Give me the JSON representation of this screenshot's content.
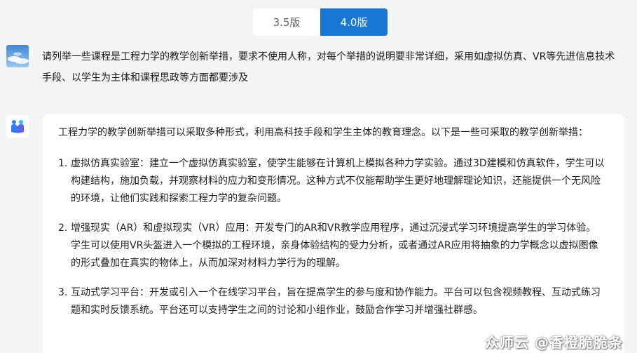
{
  "version_toggle": {
    "options": [
      {
        "label": "3.5版",
        "active": false
      },
      {
        "label": "4.0版",
        "active": true
      }
    ],
    "active_color": "#1976d2"
  },
  "user_message": {
    "avatar_icon": "user-avatar-sky-icon",
    "text": "请列举一些课程是工程力学的教学创新举措，要求不使用人称，对每个举措的说明要非常详细，采用如虚拟仿真、VR等先进信息技术手段、以学生为主体和课程思政等方面都要涉及"
  },
  "bot_message": {
    "avatar_icon": "bot-logo-icon",
    "intro": "工程力学的教学创新举措可以采取多种形式，利用高科技手段和学生主体的教育理念。以下是一些可采取的教学创新举措：",
    "items": [
      {
        "num": "1.",
        "text": "虚拟仿真实验室：建立一个虚拟仿真实验室，使学生能够在计算机上模拟各种力学实验。通过3D建模和仿真软件，学生可以构建结构，施加负载，并观察材料的应力和变形情况。这种方式不仅能帮助学生更好地理解理论知识，还能提供一个无风险的环境，让他们实践和探索工程力学的复杂问题。"
      },
      {
        "num": "2.",
        "text": "增强现实（AR）和虚拟现实（VR）应用：开发专门的AR和VR教学应用程序，通过沉浸式学习环境提高学生的学习体验。学生可以使用VR头盔进入一个模拟的工程环境，亲身体验结构的受力分析，或者通过AR应用将抽象的力学概念以虚拟图像的形式叠加在真实的物体上，从而加深对材料力学行为的理解。"
      },
      {
        "num": "3.",
        "text": "互动式学习平台：开发或引入一个在线学习平台，旨在提高学生的参与度和协作能力。平台可以包含视频教程、互动式练习题和实时反馈系统。平台还可以支持学生之间的讨论和小组作业，鼓励合作学习并增强社群感。"
      }
    ]
  },
  "watermark": "众师云 @香橙脆脆条"
}
